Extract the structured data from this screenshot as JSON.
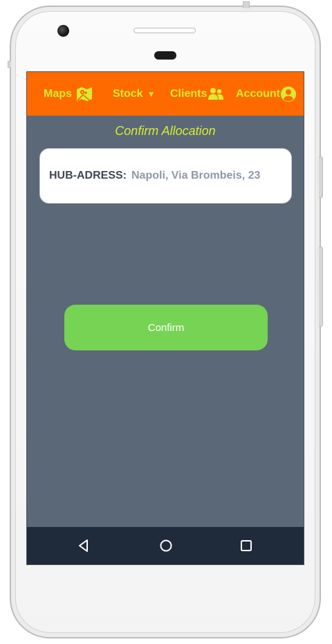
{
  "topbar": {
    "background": "#ff6a00",
    "accent": "#d8ec2e",
    "items": [
      {
        "label": "Maps",
        "icon": "map-icon"
      },
      {
        "label": "Stock",
        "icon": "caret-down-icon"
      },
      {
        "label": "Clients",
        "icon": "users-icon"
      },
      {
        "label": "Account",
        "icon": "account-circle-icon"
      }
    ]
  },
  "main": {
    "title": "Confirm Allocation",
    "hub": {
      "label": "HUB-ADRESS:",
      "value": "Napoli, Via Brombeis, 23"
    },
    "confirm_label": "Confirm",
    "confirm_color": "#77d353",
    "background": "#5a6878"
  },
  "android_nav": {
    "icons": [
      "back-icon",
      "home-icon",
      "recent-apps-icon"
    ],
    "background": "#1f2b3a"
  }
}
